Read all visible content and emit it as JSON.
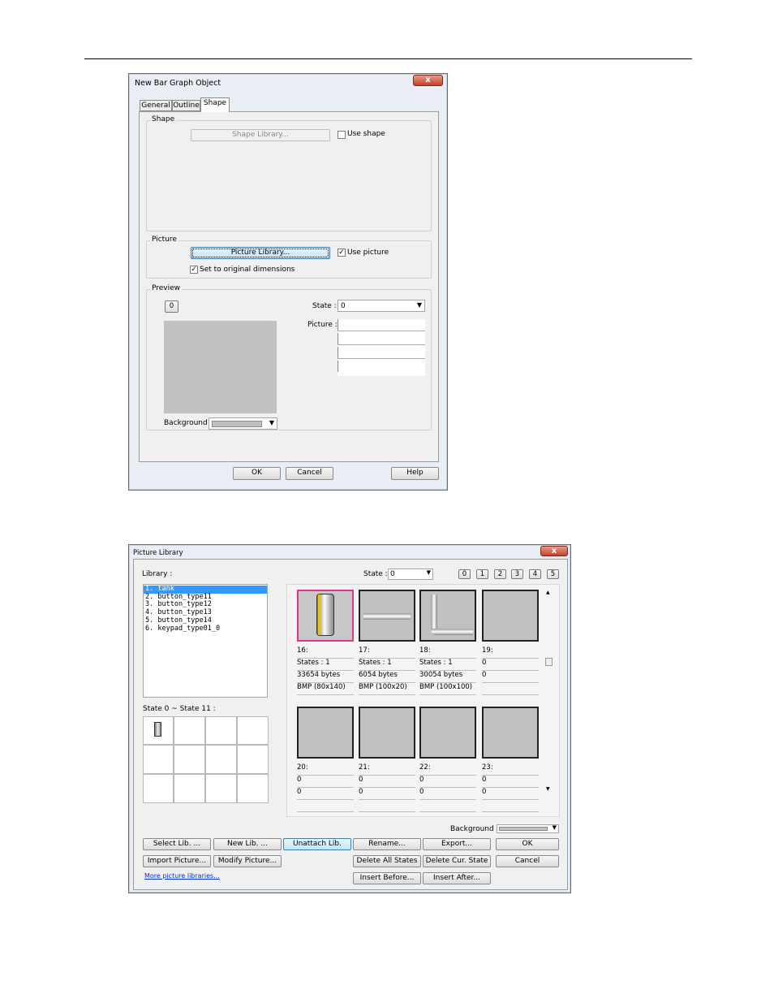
{
  "dialog1": {
    "title": "New  Bar Graph Object",
    "close": "x",
    "tabs": [
      "General",
      "Outline",
      "Shape"
    ],
    "shape_group": {
      "label": "Shape",
      "library_button": "Shape Library...",
      "use_shape_label": "Use shape",
      "use_shape_checked": false
    },
    "picture_group": {
      "label": "Picture",
      "library_button": "Picture Library...",
      "use_picture_label": "Use picture",
      "use_picture_checked": true,
      "set_original_label": "Set to original dimensions",
      "set_original_checked": true
    },
    "preview_group": {
      "label": "Preview",
      "state_button": "0",
      "state_label": "State :",
      "state_value": "0",
      "picture_label": "Picture :",
      "background_label": "Background :"
    },
    "buttons": {
      "ok": "OK",
      "cancel": "Cancel",
      "help": "Help"
    }
  },
  "dialog2": {
    "title": "Picture Library",
    "close": "x",
    "library_label": "Library :",
    "state_label": "State :",
    "state_value": "0",
    "state_buttons": [
      "0",
      "1",
      "2",
      "3",
      "4",
      "5"
    ],
    "libraries": [
      "1. tank",
      "2. button_type11",
      "3. button_type12",
      "4. button_type13",
      "5. button_type14",
      "6. keypad_type01_0"
    ],
    "state_range": "State 0 ~ State 11 :",
    "pictures_row1": [
      {
        "id": "16:",
        "states": "States : 1",
        "size": "33654 bytes",
        "format": "BMP (80x140)"
      },
      {
        "id": "17:",
        "states": "States : 1",
        "size": "6054 bytes",
        "format": "BMP (100x20)"
      },
      {
        "id": "18:",
        "states": "States : 1",
        "size": "30054 bytes",
        "format": "BMP (100x100)"
      },
      {
        "id": "19:",
        "states": "0",
        "size": "0",
        "format": ""
      }
    ],
    "pictures_row2": [
      {
        "id": "20:",
        "states": "0",
        "size": "0"
      },
      {
        "id": "21:",
        "states": "0",
        "size": "0"
      },
      {
        "id": "22:",
        "states": "0",
        "size": "0"
      },
      {
        "id": "23:",
        "states": "0",
        "size": "0"
      }
    ],
    "background_label": "Background :",
    "buttons": {
      "select_lib": "Select Lib. ...",
      "new_lib": "New Lib. ...",
      "unattach_lib": "Unattach Lib.",
      "rename": "Rename...",
      "export": "Export...",
      "ok": "OK",
      "import_picture": "Import Picture...",
      "modify_picture": "Modify Picture...",
      "delete_all_states": "Delete All States",
      "delete_cur_state": "Delete Cur. State",
      "cancel": "Cancel",
      "insert_before": "Insert Before...",
      "insert_after": "Insert After..."
    },
    "more_link": "More picture libraries..."
  }
}
